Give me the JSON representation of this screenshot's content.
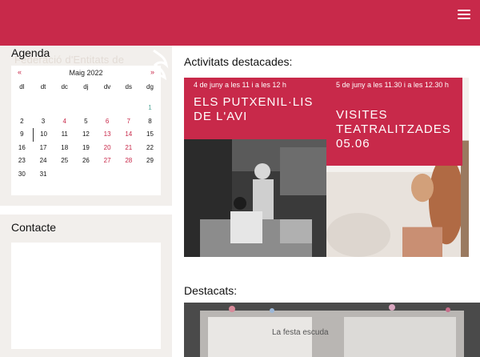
{
  "header": {
    "menu_icon": "hamburger-menu-icon",
    "brand_color": "#c8294a"
  },
  "sidebar": {
    "agenda": {
      "title": "Agenda",
      "watermark": "Federació d'Entitats de",
      "calendar": {
        "month": "Maig 2022",
        "prev": "«",
        "next": "»",
        "weekdays": [
          "dl",
          "dt",
          "dc",
          "dj",
          "dv",
          "ds",
          "dg"
        ],
        "weeks": [
          [
            "",
            "",
            "",
            "",
            "",
            "",
            "1"
          ],
          [
            "2",
            "3",
            "4",
            "5",
            "6",
            "7",
            "8"
          ],
          [
            "9",
            "10",
            "11",
            "12",
            "13",
            "14",
            "15"
          ],
          [
            "16",
            "17",
            "18",
            "19",
            "20",
            "21",
            "22"
          ],
          [
            "23",
            "24",
            "25",
            "26",
            "27",
            "28",
            "29"
          ],
          [
            "30",
            "31",
            "",
            "",
            "",
            "",
            ""
          ]
        ]
      }
    },
    "contacte": {
      "title": "Contacte"
    }
  },
  "main": {
    "featured_title": "Activitats destacades:",
    "cards": [
      {
        "date": "4 de juny a les 11 i a les 12 h",
        "title": "Els Putxenil·lis de l'Avi"
      },
      {
        "date": "5 de juny a les 11.30 i a les 12.30 h",
        "title": "Visites teatralitzades 05.06"
      }
    ],
    "highlights_title": "Destacats:",
    "highlights_photo_text": "La festa escuda"
  }
}
